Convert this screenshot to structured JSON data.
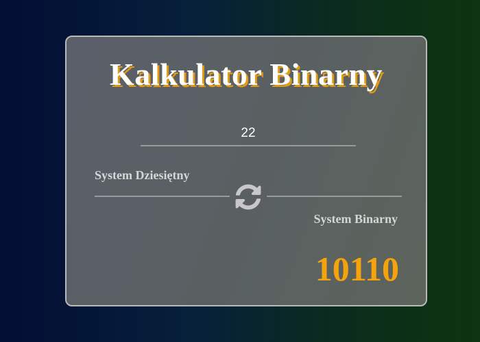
{
  "title": "Kalkulator Binarny",
  "input": {
    "value": "22"
  },
  "conversion": {
    "from_label": "System Dziesiętny",
    "to_label": "System Binarny",
    "swap_icon": "refresh-icon"
  },
  "result": "10110",
  "colors": {
    "title_text": "#ffffff",
    "title_shadow": "#e39a14",
    "result": "#f5a30c",
    "label": "#d6d6d6",
    "icon": "#c8c8c8"
  }
}
